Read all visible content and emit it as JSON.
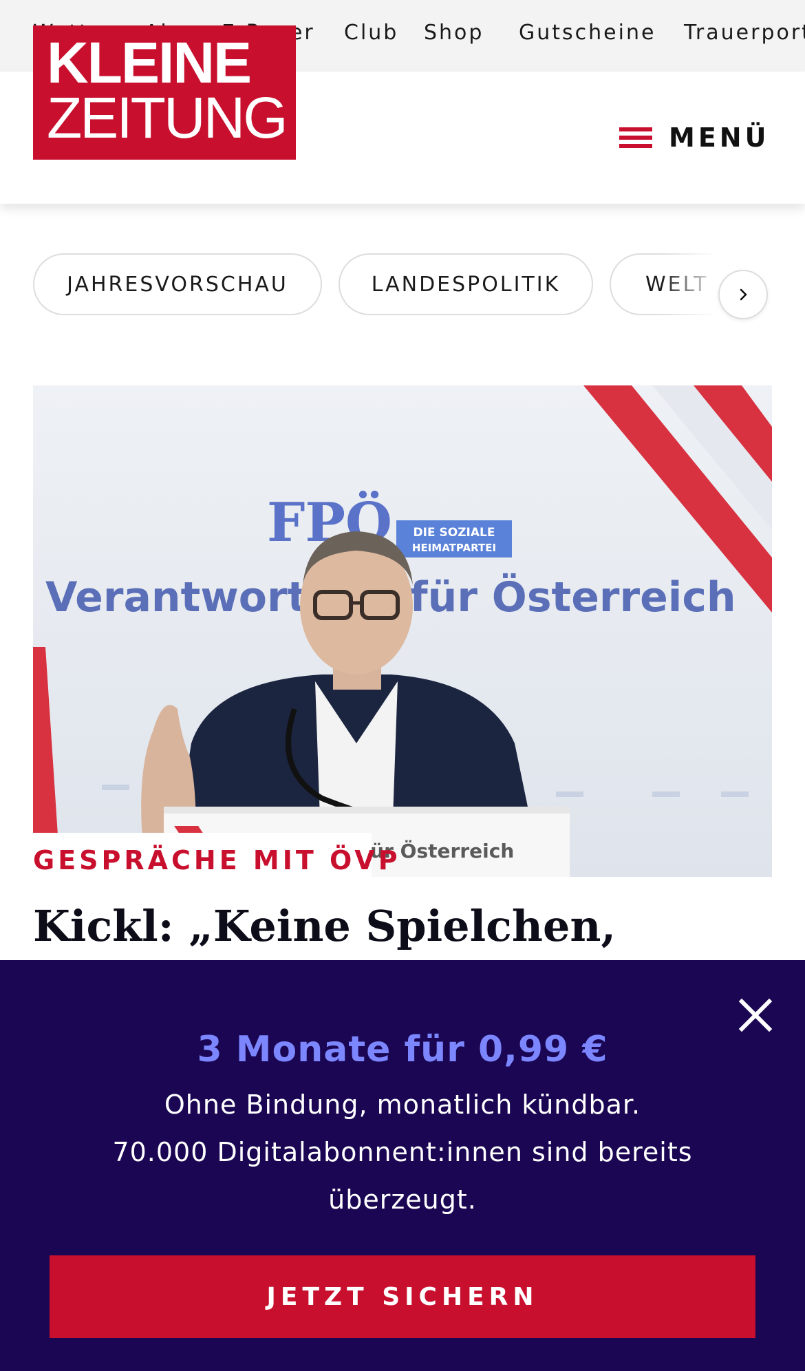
{
  "topnav": {
    "items": [
      "Wetter",
      "Abo",
      "E-Paper",
      "Club",
      "Shop",
      "Gutscheine",
      "Trauerportal"
    ]
  },
  "header": {
    "logo_line1": "KLEINE",
    "logo_line2": "ZEITUNG",
    "menu_label": "MENÜ"
  },
  "topics": {
    "items": [
      "JAHRESVORSCHAU",
      "LANDESPOLITIK",
      "WELT"
    ]
  },
  "article": {
    "kicker": "GESPRÄCHE MIT ÖVP",
    "headline": "Kickl: „Keine Spielchen,",
    "image": {
      "banner_party": "FPÖ",
      "banner_badge_line1": "DIE SOZIALE",
      "banner_badge_line2": "HEIMATPARTEI",
      "banner_slogan": "Verantwortung für Österreich",
      "lectern_text": "für Österreich"
    }
  },
  "promo": {
    "title": "3 Monate für 0,99 €",
    "line1": "Ohne Bindung, monatlich kündbar.",
    "line2": "70.000 Digitalabonnent:innen sind bereits überzeugt.",
    "cta": "JETZT SICHERN"
  },
  "colors": {
    "brand_red": "#c8102e",
    "promo_bg": "#1a0652",
    "promo_accent": "#7b86ff"
  }
}
